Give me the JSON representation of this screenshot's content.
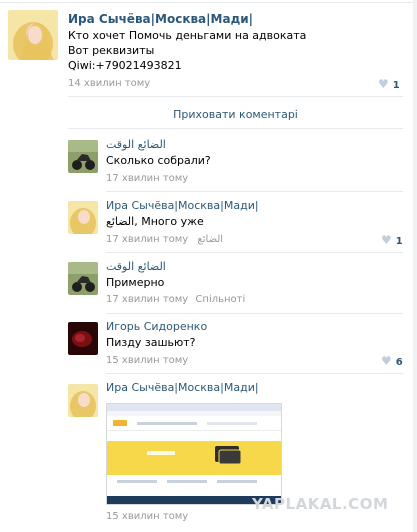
{
  "post": {
    "author": "Ира Сычёва|Москва|Мади|",
    "text_lines": [
      "Кто хочет Помочь деньгами на адвоката",
      "Вот реквизиты",
      "Qiwi:+79021493821"
    ],
    "time": "14 хвилин тому",
    "likes": "1"
  },
  "hide_comments": "Приховати коментарі",
  "comments": [
    {
      "author": "الضائع الوقت",
      "text": "Сколько собрали?",
      "time": "17 хвилин тому",
      "reply": "",
      "likes": ""
    },
    {
      "author": "Ира Сычёва|Москва|Мади|",
      "text": "الضائع, Много уже",
      "time": "17 хвилин тому",
      "reply": "الضائع",
      "likes": "1"
    },
    {
      "author": "الضائع الوقت",
      "text": "Примерно",
      "time": "17 хвилин тому",
      "reply": "Спільноті",
      "likes": ""
    },
    {
      "author": "Игорь Сидоренко",
      "text": "Пизду зашьют?",
      "time": "15 хвилин тому",
      "reply": "",
      "likes": "6"
    },
    {
      "author": "Ира Сычёва|Москва|Мади|",
      "text": "",
      "time": "15 хвилин тому",
      "reply": "",
      "likes": ""
    }
  ],
  "watermark": "YAPLAKAL.COM",
  "colors": {
    "link": "#2b587a",
    "meta": "#999999",
    "heart": "#c3cedb",
    "screenshot_yellow": "#f6d84a"
  }
}
